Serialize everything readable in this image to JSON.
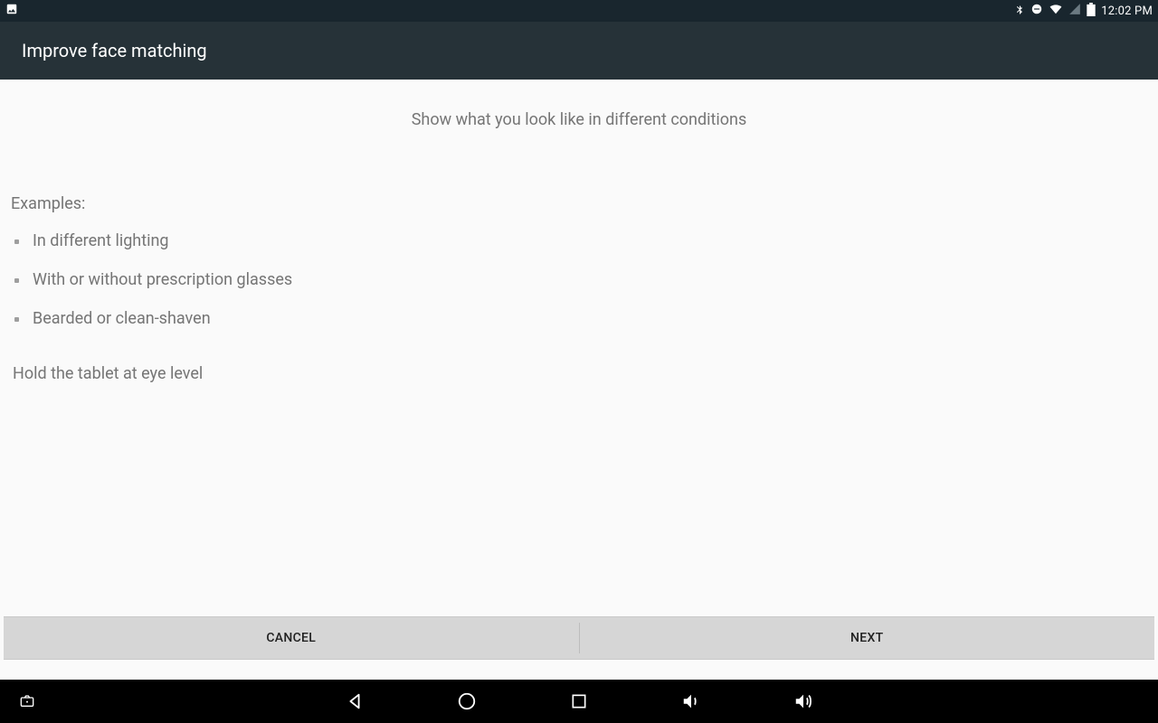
{
  "status": {
    "time": "12:02 PM"
  },
  "appbar": {
    "title": "Improve face matching"
  },
  "content": {
    "subtitle": "Show what you look like in different conditions",
    "examples_heading": "Examples:",
    "examples": [
      "In different lighting",
      "With or without prescription glasses",
      "Bearded or clean-shaven"
    ],
    "instruction": "Hold the tablet at eye level"
  },
  "buttons": {
    "cancel": "Cancel",
    "next": "Next"
  }
}
